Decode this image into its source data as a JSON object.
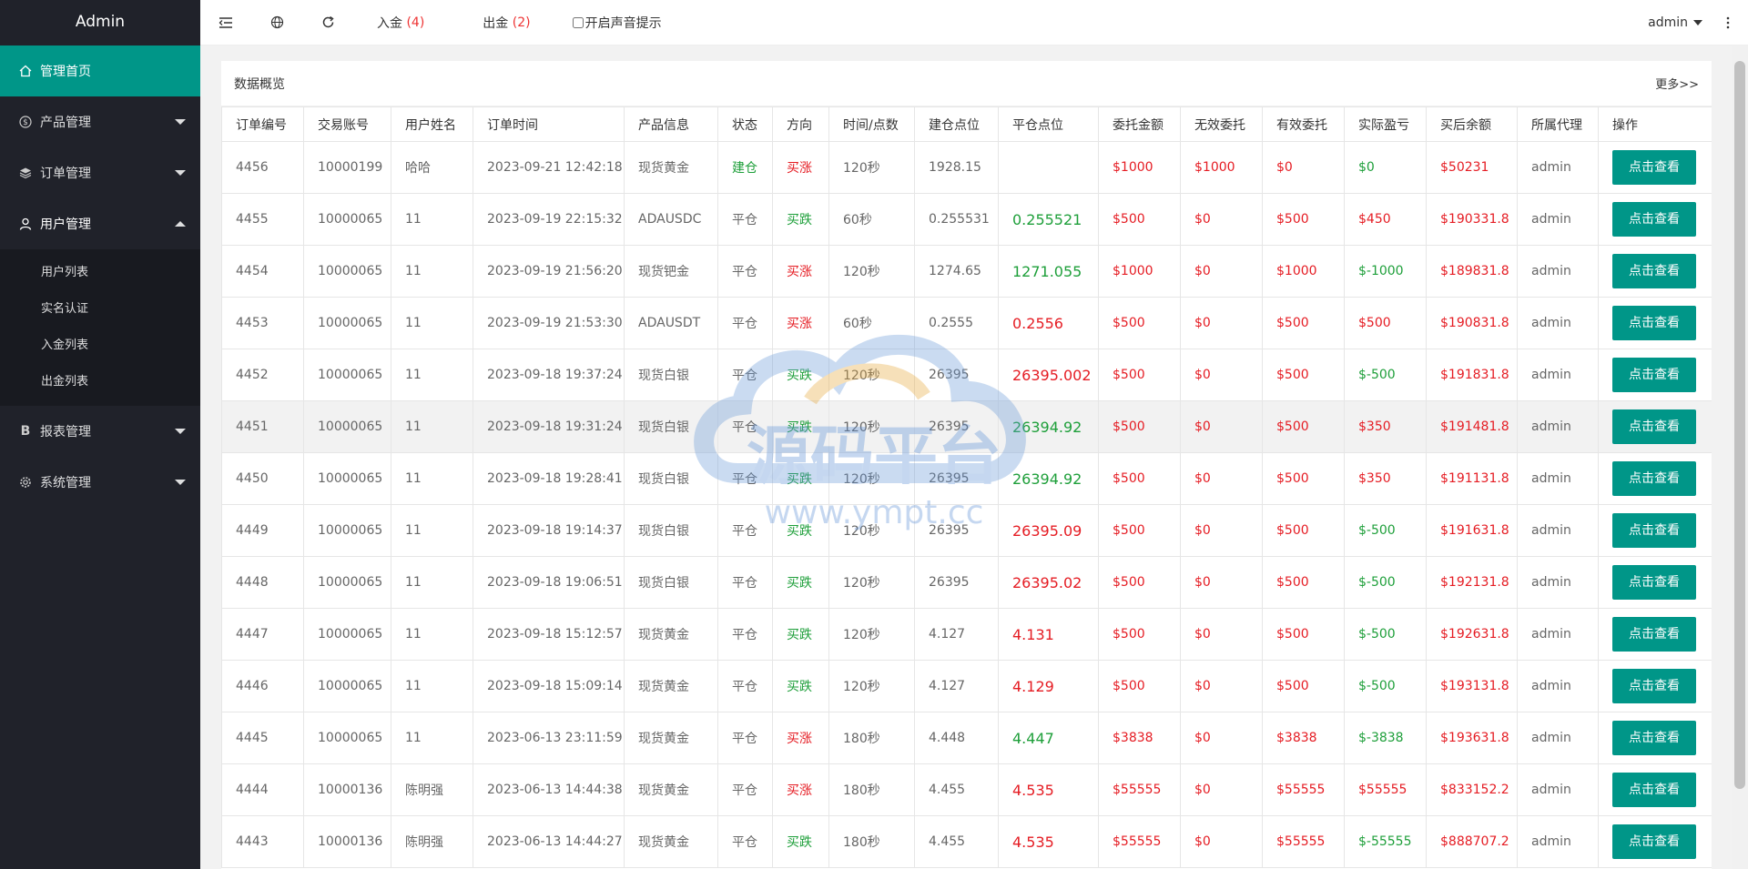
{
  "sidebar": {
    "title": "Admin",
    "items": [
      {
        "label": "管理首页"
      },
      {
        "label": "产品管理"
      },
      {
        "label": "订单管理"
      },
      {
        "label": "用户管理"
      },
      {
        "label": "报表管理"
      },
      {
        "label": "系统管理"
      }
    ],
    "sub_items": [
      {
        "label": "用户列表"
      },
      {
        "label": "实名认证"
      },
      {
        "label": "入金列表"
      },
      {
        "label": "出金列表"
      }
    ]
  },
  "header": {
    "deposit_label": "入金",
    "deposit_count": "(4)",
    "withdraw_label": "出金",
    "withdraw_count": "(2)",
    "sound_label": "开启声音提示",
    "user": "admin"
  },
  "card": {
    "title": "数据概览",
    "more": "更多>>"
  },
  "watermark": {
    "text": "源码平台",
    "url": "www.ympt.cc"
  },
  "table": {
    "headers": [
      "订单编号",
      "交易账号",
      "用户姓名",
      "订单时间",
      "产品信息",
      "状态",
      "方向",
      "时间/点数",
      "建仓点位",
      "平仓点位",
      "委托金额",
      "无效委托",
      "有效委托",
      "实际盈亏",
      "买后余额",
      "所属代理",
      "操作"
    ],
    "button_label": "点击查看",
    "rows": [
      [
        "4456",
        "10000199",
        "哈哈",
        "2023-09-21 12:42:18",
        "现货黄金",
        "建仓",
        "买涨",
        "120秒",
        "1928.15",
        "",
        "$1000",
        "$1000",
        "$0",
        "$0",
        "$50231",
        "admin"
      ],
      [
        "4455",
        "10000065",
        "11",
        "2023-09-19 22:15:32",
        "ADAUSDC",
        "平仓",
        "买跌",
        "60秒",
        "0.255531",
        "0.255521",
        "$500",
        "$0",
        "$500",
        "$450",
        "$190331.8",
        "admin"
      ],
      [
        "4454",
        "10000065",
        "11",
        "2023-09-19 21:56:20",
        "现货钯金",
        "平仓",
        "买涨",
        "120秒",
        "1274.65",
        "1271.055",
        "$1000",
        "$0",
        "$1000",
        "$-1000",
        "$189831.8",
        "admin"
      ],
      [
        "4453",
        "10000065",
        "11",
        "2023-09-19 21:53:30",
        "ADAUSDT",
        "平仓",
        "买涨",
        "60秒",
        "0.2555",
        "0.2556",
        "$500",
        "$0",
        "$500",
        "$500",
        "$190831.8",
        "admin"
      ],
      [
        "4452",
        "10000065",
        "11",
        "2023-09-18 19:37:24",
        "现货白银",
        "平仓",
        "买跌",
        "120秒",
        "26395",
        "26395.002",
        "$500",
        "$0",
        "$500",
        "$-500",
        "$191831.8",
        "admin"
      ],
      [
        "4451",
        "10000065",
        "11",
        "2023-09-18 19:31:24",
        "现货白银",
        "平仓",
        "买跌",
        "120秒",
        "26395",
        "26394.92",
        "$500",
        "$0",
        "$500",
        "$350",
        "$191481.8",
        "admin"
      ],
      [
        "4450",
        "10000065",
        "11",
        "2023-09-18 19:28:41",
        "现货白银",
        "平仓",
        "买跌",
        "120秒",
        "26395",
        "26394.92",
        "$500",
        "$0",
        "$500",
        "$350",
        "$191131.8",
        "admin"
      ],
      [
        "4449",
        "10000065",
        "11",
        "2023-09-18 19:14:37",
        "现货白银",
        "平仓",
        "买跌",
        "120秒",
        "26395",
        "26395.09",
        "$500",
        "$0",
        "$500",
        "$-500",
        "$191631.8",
        "admin"
      ],
      [
        "4448",
        "10000065",
        "11",
        "2023-09-18 19:06:51",
        "现货白银",
        "平仓",
        "买跌",
        "120秒",
        "26395",
        "26395.02",
        "$500",
        "$0",
        "$500",
        "$-500",
        "$192131.8",
        "admin"
      ],
      [
        "4447",
        "10000065",
        "11",
        "2023-09-18 15:12:57",
        "现货黄金",
        "平仓",
        "买跌",
        "120秒",
        "4.127",
        "4.131",
        "$500",
        "$0",
        "$500",
        "$-500",
        "$192631.8",
        "admin"
      ],
      [
        "4446",
        "10000065",
        "11",
        "2023-09-18 15:09:14",
        "现货黄金",
        "平仓",
        "买跌",
        "120秒",
        "4.127",
        "4.129",
        "$500",
        "$0",
        "$500",
        "$-500",
        "$193131.8",
        "admin"
      ],
      [
        "4445",
        "10000065",
        "11",
        "2023-06-13 23:11:59",
        "现货黄金",
        "平仓",
        "买涨",
        "180秒",
        "4.448",
        "4.447",
        "$3838",
        "$0",
        "$3838",
        "$-3838",
        "$193631.8",
        "admin"
      ],
      [
        "4444",
        "10000136",
        "陈明强",
        "2023-06-13 14:44:38",
        "现货黄金",
        "平仓",
        "买涨",
        "180秒",
        "4.455",
        "4.535",
        "$55555",
        "$0",
        "$55555",
        "$55555",
        "$833152.2",
        "admin"
      ],
      [
        "4443",
        "10000136",
        "陈明强",
        "2023-06-13 14:44:27",
        "现货黄金",
        "平仓",
        "买跌",
        "180秒",
        "4.455",
        "4.535",
        "$55555",
        "$0",
        "$55555",
        "$-55555",
        "$888707.2",
        "admin"
      ]
    ]
  }
}
